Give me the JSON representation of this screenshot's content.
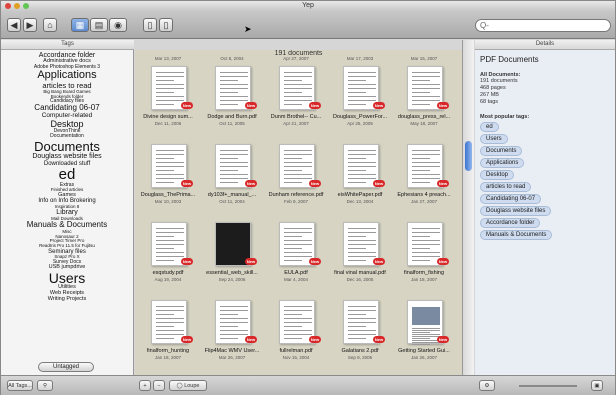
{
  "window": {
    "title": "Yep"
  },
  "toolbar": {
    "back_icon": "back-arrow-icon",
    "forward_icon": "forward-arrow-icon",
    "home_icon": "home-icon",
    "view_icons": [
      "grid-view-icon",
      "list-view-icon",
      "circle-view-icon"
    ],
    "layout_icons": [
      "columns-icon",
      "sidebar-icon"
    ],
    "search_placeholder": "Q-"
  },
  "tags_pane": {
    "header": "Tags",
    "untagged_label": "Untagged",
    "tags": [
      {
        "label": "Accordance folder",
        "size": 7
      },
      {
        "label": "Administrative docs",
        "size": 5.5
      },
      {
        "label": "Adobe Photoshop Elements 3",
        "size": 5
      },
      {
        "label": "Applications",
        "size": 11
      },
      {
        "label": "articles to read",
        "size": 7.5
      },
      {
        "label": "Big Bang Board Games",
        "size": 4.5
      },
      {
        "label": "Bookends folder",
        "size": 4.5
      },
      {
        "label": "Candidacy files",
        "size": 5
      },
      {
        "label": "Candidating 06-07",
        "size": 8
      },
      {
        "label": "Computer-related",
        "size": 6.5
      },
      {
        "label": "Desktop",
        "size": 9
      },
      {
        "label": "DevonThink",
        "size": 5
      },
      {
        "label": "Documentation",
        "size": 5
      },
      {
        "label": "Documents",
        "size": 13
      },
      {
        "label": "Douglass website files",
        "size": 7
      },
      {
        "label": "Downloaded stuff",
        "size": 6
      },
      {
        "label": "ed",
        "size": 15
      },
      {
        "label": "Extras",
        "size": 5
      },
      {
        "label": "Finished articles",
        "size": 4.5
      },
      {
        "label": "Games",
        "size": 5.5
      },
      {
        "label": "Info on Info Brokering",
        "size": 6
      },
      {
        "label": "Inspiration 8",
        "size": 4.5
      },
      {
        "label": "Library",
        "size": 7
      },
      {
        "label": "Mail Downloads",
        "size": 4.5
      },
      {
        "label": "Manuals & Documents",
        "size": 8
      },
      {
        "label": "Misc",
        "size": 4.5
      },
      {
        "label": "Nanosaur 2",
        "size": 4.5
      },
      {
        "label": "Project Timer Pro",
        "size": 4.5
      },
      {
        "label": "ReadIris Pro 11.5 for Fujitsu",
        "size": 4.5
      },
      {
        "label": "Seminary files",
        "size": 6
      },
      {
        "label": "Snapz Pro X",
        "size": 4.5
      },
      {
        "label": "Survey Docs",
        "size": 5
      },
      {
        "label": "USB jumpdrive",
        "size": 5.5
      },
      {
        "label": "Users",
        "size": 14
      },
      {
        "label": "Utilities",
        "size": 5.5
      },
      {
        "label": "Web Receipts",
        "size": 5.5
      },
      {
        "label": "Writing Projects",
        "size": 5.5
      }
    ]
  },
  "grid": {
    "document_count": "191 documents",
    "top_dates": [
      "Mar 13, 2007",
      "Oct 8, 2004",
      "Apr 27, 2007",
      "Mar 17, 2003",
      "Mar 15, 2007"
    ],
    "rows": [
      [
        {
          "name": "Divine design sum...",
          "date": "Dec 11, 2006",
          "new": true
        },
        {
          "name": "Dodge and Burn.pdf",
          "date": "Oct 11, 2005",
          "new": true
        },
        {
          "name": "Dunm Brothel-- Cu...",
          "date": "Apr 21, 2007",
          "new": true
        },
        {
          "name": "Douglass_PowerFor...",
          "date": "Apr 25, 2005",
          "new": true
        },
        {
          "name": "douglass_press_rel...",
          "date": "May 18, 2007",
          "new": true
        }
      ],
      [
        {
          "name": "Douglass_ThePrima...",
          "date": "Mar 10, 2003",
          "new": true
        },
        {
          "name": "dy103f+_manual_...",
          "date": "Oct 11, 2004",
          "new": true
        },
        {
          "name": "Dunham reference.pdf",
          "date": "Feb 9, 2007",
          "new": true
        },
        {
          "name": "eisWhitePaper.pdf",
          "date": "Dec 13, 2004",
          "new": true
        },
        {
          "name": "Ephesians 4 preach...",
          "date": "Jan 27, 2007",
          "new": true
        }
      ],
      [
        {
          "name": "esqstudy.pdf",
          "date": "Aug 19, 2004",
          "new": true
        },
        {
          "name": "essential_web_skill...",
          "date": "Sep 24, 2006",
          "new": true,
          "dark": true
        },
        {
          "name": "EULA.pdf",
          "date": "Mar 4, 2004",
          "new": true
        },
        {
          "name": "final vinal manual.pdf",
          "date": "Dec 16, 2005",
          "new": true
        },
        {
          "name": "finalform_fishing",
          "date": "Jan 18, 2007",
          "new": true
        }
      ],
      [
        {
          "name": "finalform_hunting",
          "date": "Jan 18, 2007",
          "new": true
        },
        {
          "name": "Flip4Mac WMV User...",
          "date": "Mar 26, 2007",
          "new": true
        },
        {
          "name": "fullrelman.pdf",
          "date": "Nov 15, 2004",
          "new": true
        },
        {
          "name": "Galatians 2.pdf",
          "date": "Sep 9, 2006",
          "new": true
        },
        {
          "name": "Getting Started Gui...",
          "date": "Jan 26, 2007",
          "new": true,
          "image": true
        }
      ]
    ],
    "new_badge": "New"
  },
  "details": {
    "header": "Details",
    "title": "PDF Documents",
    "all_docs_label": "All Documents:",
    "stats": [
      "191 documents",
      "468 pages",
      "267 MB",
      "68 tags"
    ],
    "popular_label": "Most popular tags:",
    "popular_tags": [
      "ed",
      "Users",
      "Documents",
      "Applications",
      "Desktop",
      "articles to read",
      "Candidating 06-07",
      "Douglass website files",
      "Accordance folder",
      "Manuals & Documents"
    ]
  },
  "bottombar": {
    "all_tags_label": "All Tags...",
    "add_label": "+",
    "remove_label": "−",
    "loupe_label": "Loupe",
    "gear_icon": "gear-icon",
    "zoom_icon": "zoom-icon"
  }
}
